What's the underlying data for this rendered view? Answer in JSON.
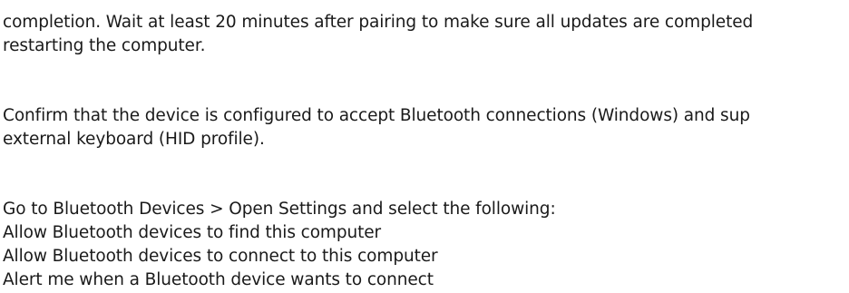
{
  "document": {
    "paragraph_1": {
      "line_1": "completion. Wait at least 20 minutes after pairing to make sure all updates are completed",
      "line_2": "restarting the computer."
    },
    "paragraph_2": {
      "line_1": "Confirm that the device is configured to accept Bluetooth connections (Windows) and sup",
      "line_2": "external keyboard (HID profile)."
    },
    "paragraph_3": {
      "line_1": "Go to Bluetooth Devices > Open Settings and select the following:",
      "line_2": "Allow Bluetooth devices to find this computer",
      "line_3": "Allow Bluetooth devices to connect to this computer",
      "line_4": "Alert me when a Bluetooth device wants to connect"
    }
  }
}
